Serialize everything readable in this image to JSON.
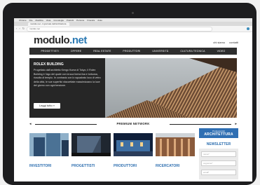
{
  "os_menubar": {
    "items": [
      "Chrome",
      "File",
      "Modifica",
      "Vista",
      "Cronologia",
      "Preferiti",
      "Persone",
      "Finestra",
      "Aiuto"
    ]
  },
  "browser": {
    "tab_title": "modulo.net - il giornale dell'architettura",
    "url": "modulo.net"
  },
  "site": {
    "logo_main": "modulo",
    "logo_dot": ".net",
    "header_links": [
      "chi siamo",
      "contatti"
    ],
    "nav": [
      "PROGETTISTI",
      "OFFERE",
      "REAL ESTATE",
      "PRODUTTORI",
      "UNIVERSITÀ",
      "CULTURA TECNICA",
      "VIDEO"
    ],
    "hero": {
      "title": "ROLEX BUILDING",
      "text": "Progettato dall'architetto Kengo Kuma di Tokyo, il Rolex Building è l'ago del quale con la sua forma lisa e tortuosa, riuscita di tempio. In contrasto con lo squadrato loco di vetro della città, le sue superfici sfaccettate massimizzano la luce del giorno con ogni tensione.",
      "button": "Leggi tutto »"
    },
    "premium_label": "PREMIUM NETWORK",
    "cards": [
      "INVESTITORI",
      "PROGETTISTI",
      "PRODUTTORI",
      "RICERCATORI"
    ],
    "sidebar": {
      "arch_small": "Professionisti",
      "arch_big": "ARCHITETTURA",
      "newsletter_title": "NEWSLETTER",
      "name_placeholder": "nome*",
      "surname_placeholder": "cognome*",
      "email_placeholder": "email*"
    }
  },
  "colors": {
    "accent": "#2e6fb0",
    "nav_bg": "#2e2e2e",
    "hero_bg": "#262626"
  }
}
